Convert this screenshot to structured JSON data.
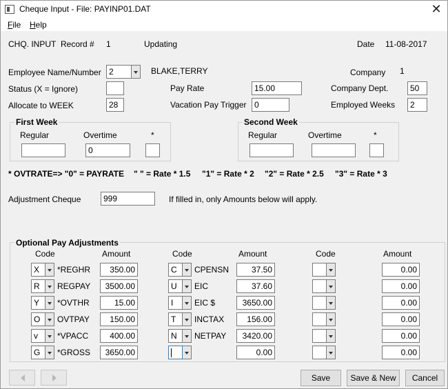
{
  "window": {
    "title": "Cheque Input - File: PAYINP01.DAT",
    "close_glyph": "✕"
  },
  "menu": {
    "file": "File",
    "help": "Help"
  },
  "header": {
    "screen_name": "CHQ. INPUT",
    "record_label": "Record #",
    "record_value": "1",
    "mode": "Updating",
    "date_label": "Date",
    "date_value": "11-08-2017"
  },
  "employee": {
    "name_number_label": "Employee Name/Number",
    "number": "2",
    "name": "BLAKE,TERRY",
    "company_label": "Company",
    "company_value": "1",
    "status_label": "Status (X = Ignore)",
    "status_value": "",
    "allocate_label": "Allocate to WEEK",
    "allocate_value": "28",
    "pay_rate_label": "Pay Rate",
    "pay_rate_value": "15.00",
    "vacation_trigger_label": "Vacation Pay Trigger",
    "vacation_trigger_value": "0",
    "company_dept_label": "Company Dept.",
    "company_dept_value": "50",
    "employed_weeks_label": "Employed Weeks",
    "employed_weeks_value": "2"
  },
  "first_week": {
    "title": "First Week",
    "regular_label": "Regular",
    "overtime_label": "Overtime",
    "star_label": "*",
    "regular_value": "",
    "overtime_value": "0",
    "star_value": ""
  },
  "second_week": {
    "title": "Second Week",
    "regular_label": "Regular",
    "overtime_label": "Overtime",
    "star_label": "*",
    "regular_value": "",
    "overtime_value": "",
    "star_value": ""
  },
  "ovtrate": {
    "prefix": "* OVTRATE=> \"0\" = PAYRATE",
    "r1": "\" \" = Rate * 1.5",
    "r2": "\"1\" = Rate * 2",
    "r3": "\"2\" = Rate * 2.5",
    "r4": "\"3\" = Rate * 3"
  },
  "adjustment": {
    "label": "Adjustment Cheque",
    "value": "999",
    "note": "If filled in, only Amounts below will apply."
  },
  "optional": {
    "title": "Optional Pay Adjustments",
    "code_header": "Code",
    "amount_header": "Amount",
    "col1": [
      {
        "code": "X",
        "name": "*REGHR",
        "amount": "350.00"
      },
      {
        "code": "R",
        "name": "REGPAY",
        "amount": "3500.00"
      },
      {
        "code": "Y",
        "name": "*OVTHR",
        "amount": "15.00"
      },
      {
        "code": "O",
        "name": "OVTPAY",
        "amount": "150.00"
      },
      {
        "code": "v",
        "name": "*VPACC",
        "amount": "400.00"
      },
      {
        "code": "G",
        "name": "*GROSS",
        "amount": "3650.00"
      }
    ],
    "col2": [
      {
        "code": "C",
        "name": "CPENSN",
        "amount": "37.50"
      },
      {
        "code": "U",
        "name": "EIC",
        "amount": "37.60"
      },
      {
        "code": "I",
        "name": "EIC $",
        "amount": "3650.00"
      },
      {
        "code": "T",
        "name": "INCTAX",
        "amount": "156.00"
      },
      {
        "code": "N",
        "name": "NETPAY",
        "amount": "3420.00"
      },
      {
        "code": "",
        "name": "",
        "amount": "0.00"
      }
    ],
    "col3": [
      {
        "code": "",
        "name": "",
        "amount": "0.00"
      },
      {
        "code": "",
        "name": "",
        "amount": "0.00"
      },
      {
        "code": "",
        "name": "",
        "amount": "0.00"
      },
      {
        "code": "",
        "name": "",
        "amount": "0.00"
      },
      {
        "code": "",
        "name": "",
        "amount": "0.00"
      },
      {
        "code": "",
        "name": "",
        "amount": "0.00"
      }
    ]
  },
  "buttons": {
    "save": "Save",
    "save_new": "Save & New",
    "cancel": "Cancel"
  }
}
